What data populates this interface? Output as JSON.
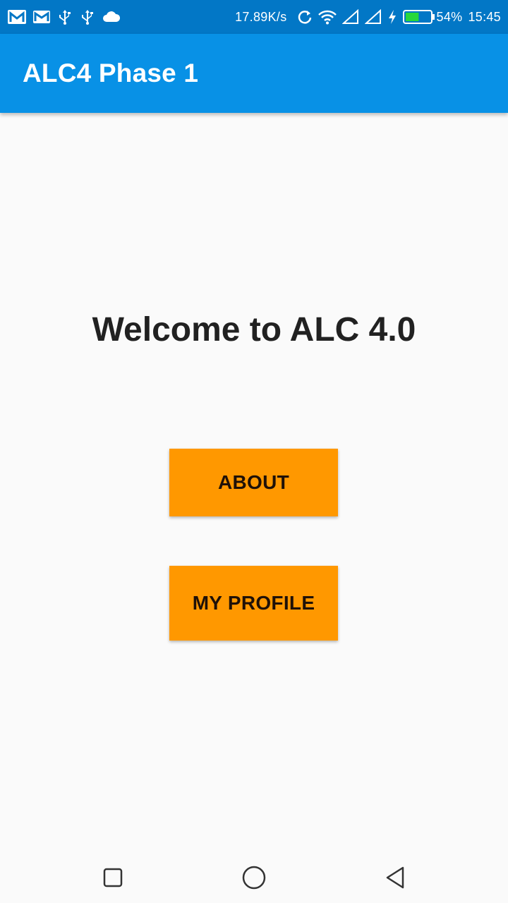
{
  "status_bar": {
    "network_speed": "17.89K/s",
    "battery_percent": "54%",
    "time": "15:45",
    "battery_level": 0.54,
    "left_icons": [
      "gmail-icon",
      "gmail-icon",
      "usb-icon",
      "usb-icon",
      "cloud-icon"
    ],
    "right_icons": [
      "sync-icon",
      "wifi-icon",
      "signal-icon",
      "signal-icon",
      "charging-icon",
      "battery-icon"
    ]
  },
  "app_bar": {
    "title": "ALC4 Phase 1",
    "color": "#0891e6"
  },
  "main": {
    "welcome_text": "Welcome to ALC 4.0",
    "buttons": {
      "about_label": "ABOUT",
      "profile_label": "MY PROFILE"
    },
    "button_color": "#ff9800"
  },
  "nav_bar": {
    "buttons": [
      "recents-icon",
      "home-icon",
      "back-icon"
    ]
  }
}
